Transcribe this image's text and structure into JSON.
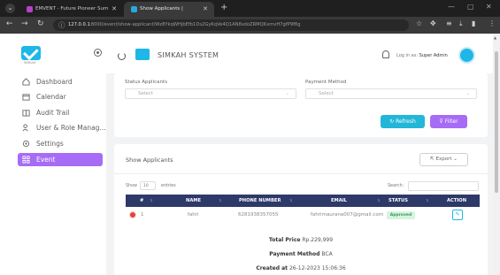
{
  "browser": {
    "tabs": [
      {
        "title": "EMVENT - Future Pioneer Sum",
        "active": false
      },
      {
        "title": "Show Applicants |",
        "active": true
      }
    ],
    "url_host": "127.0.0.1",
    "url_path": ":8000/event/show-applicant/Wz8YkqWHjbEfb1Ds2GyKqVe4Q1AN8sdoZRMQKxmvH7gfP9f8g"
  },
  "sidebar": {
    "logo_caption": "SIMKAH",
    "items": [
      {
        "label": "Dashboard",
        "icon": "home-icon"
      },
      {
        "label": "Calendar",
        "icon": "calendar-icon"
      },
      {
        "label": "Audit Trail",
        "icon": "book-icon"
      },
      {
        "label": "User & Role Manag...",
        "icon": "users-icon"
      },
      {
        "label": "Settings",
        "icon": "gear-icon"
      },
      {
        "label": "Event",
        "icon": "grid-icon",
        "active": true
      }
    ]
  },
  "header": {
    "title": "SIMKAH SYSTEM",
    "login_prefix": "Log in as:",
    "login_user": "Super Admin"
  },
  "filters": {
    "status_label": "Status Applicants",
    "status_value": "Select",
    "payment_label": "Payment Method",
    "payment_value": "Select",
    "refresh_label": "Refresh",
    "filter_label": "Filter"
  },
  "table_card": {
    "title": "Show Applicants",
    "export_label": "Export",
    "show_label": "Show",
    "show_value": "10",
    "entries_label": "entries",
    "search_label": "Search:",
    "columns": [
      "#",
      "NAME",
      "PHONE NUMBER",
      "EMAIL",
      "STATUS",
      "ACTION"
    ],
    "rows": [
      {
        "no": "1",
        "name": "fahri",
        "phone": "6281938357055",
        "email": "fahrimaurana007@gmail.com",
        "status": "Approved"
      }
    ],
    "details": {
      "total_price_label": "Total Price",
      "total_price_value": "Rp.229,999",
      "payment_method_label": "Payment Method",
      "payment_method_value": "BCA",
      "created_label": "Created at",
      "created_value": "26-12-2023 15:06:36"
    }
  },
  "colors": {
    "accent": "#a66cf5",
    "cyan": "#22b7d8",
    "table_header": "#2d3968",
    "approved": "#2f9e58"
  }
}
